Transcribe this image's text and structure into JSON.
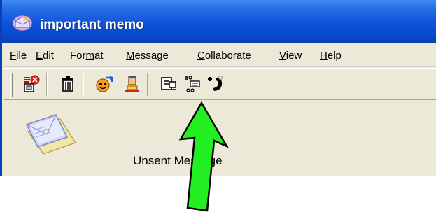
{
  "window": {
    "title": "important memo",
    "title_color": "#0a48c7"
  },
  "menubar": {
    "items": [
      {
        "label": "File",
        "mnemonic": "F",
        "rest": "ile"
      },
      {
        "label": "Edit",
        "mnemonic": "E",
        "rest": "dit"
      },
      {
        "label": "Format",
        "pre": "For",
        "mnemonic": "m",
        "rest": "at"
      },
      {
        "label": "Message",
        "mnemonic": "M",
        "rest": "essage"
      },
      {
        "label": "Collaborate",
        "mnemonic": "C",
        "rest": "ollaborate"
      },
      {
        "label": "View",
        "mnemonic": "V",
        "rest": "iew"
      },
      {
        "label": "Help",
        "mnemonic": "H",
        "rest": "elp"
      }
    ]
  },
  "toolbar": {
    "buttons": [
      {
        "icon": "cancel-message-icon"
      },
      {
        "icon": "delete-icon"
      },
      {
        "icon": "send-receive-icon"
      },
      {
        "icon": "user-icon"
      },
      {
        "icon": "edit-message-icon"
      },
      {
        "icon": "collaborate-icon"
      },
      {
        "icon": "call-icon"
      }
    ]
  },
  "content": {
    "status": "Unsent Message",
    "icon": "envelope-icon"
  },
  "annotation": {
    "arrow_color": "#22ee22",
    "arrow_target": "edit-message-icon"
  }
}
